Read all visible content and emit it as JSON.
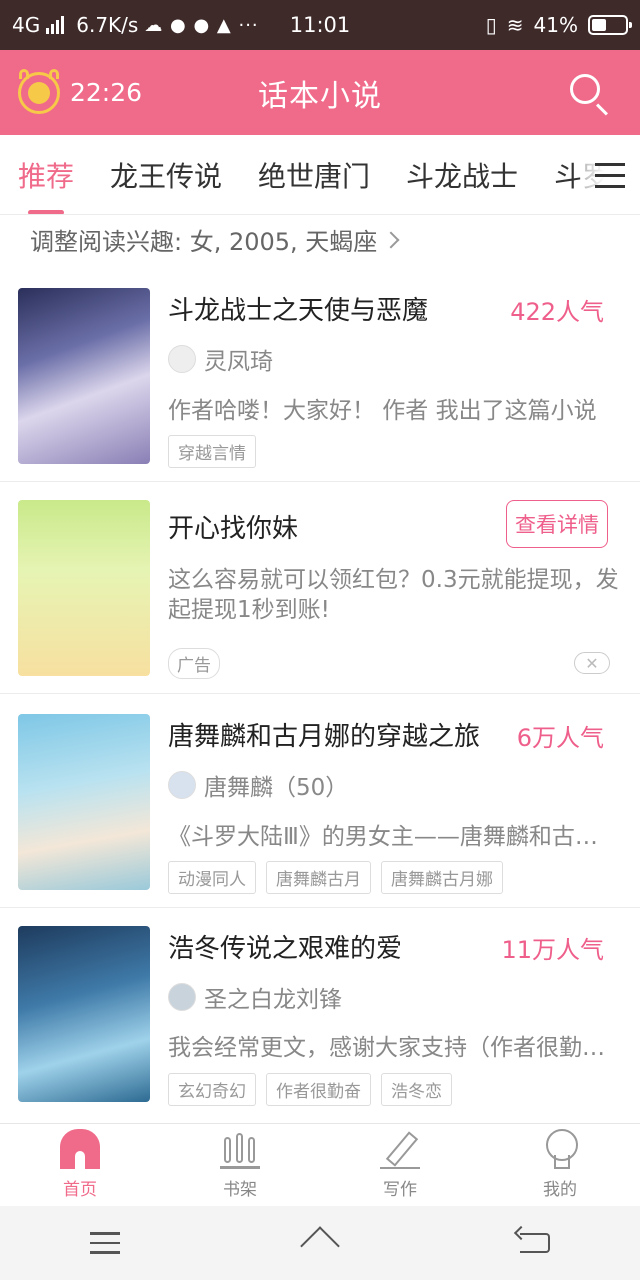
{
  "status": {
    "network": "4G",
    "speed": "6.7K/s",
    "time": "11:01",
    "battery": "41%",
    "battery_level": 0.41
  },
  "header": {
    "timer": "22:26",
    "title": "话本小说"
  },
  "tabs": [
    "推荐",
    "龙王传说",
    "绝世唐门",
    "斗龙战士",
    "斗罗"
  ],
  "interest": "调整阅读兴趣: 女, 2005, 天蝎座",
  "books": [
    {
      "title": "斗龙战士之天使与恶魔",
      "popularity": "422人气",
      "author": "灵凤琦",
      "desc": "作者哈喽！大家好！ 作者 我出了这篇小说",
      "tags": [
        "穿越言情"
      ]
    },
    {
      "title": "唐舞麟和古月娜的穿越之旅",
      "popularity": "6万人气",
      "author": "唐舞麟（50）",
      "desc": "《斗罗大陆Ⅲ》的男女主——唐舞麟和古月娜",
      "tags": [
        "动漫同人",
        "唐舞麟古月",
        "唐舞麟古月娜"
      ]
    },
    {
      "title": "浩冬传说之艰难的爱",
      "popularity": "11万人气",
      "author": "圣之白龙刘锋",
      "desc": "我会经常更文，感谢大家支持（作者很勤奋）",
      "tags": [
        "玄幻奇幻",
        "作者很勤奋",
        "浩冬恋"
      ]
    }
  ],
  "ad": {
    "title": "开心找你妹",
    "button": "查看详情",
    "desc": "这么容易就可以领红包？0.3元就能提现，发起提现1秒到账!",
    "tag": "广告",
    "close": "✕"
  },
  "bottom_nav": [
    "首页",
    "书架",
    "写作",
    "我的"
  ],
  "colors": {
    "accent": "#f06a8a",
    "statusbar": "#3f2a2a"
  }
}
